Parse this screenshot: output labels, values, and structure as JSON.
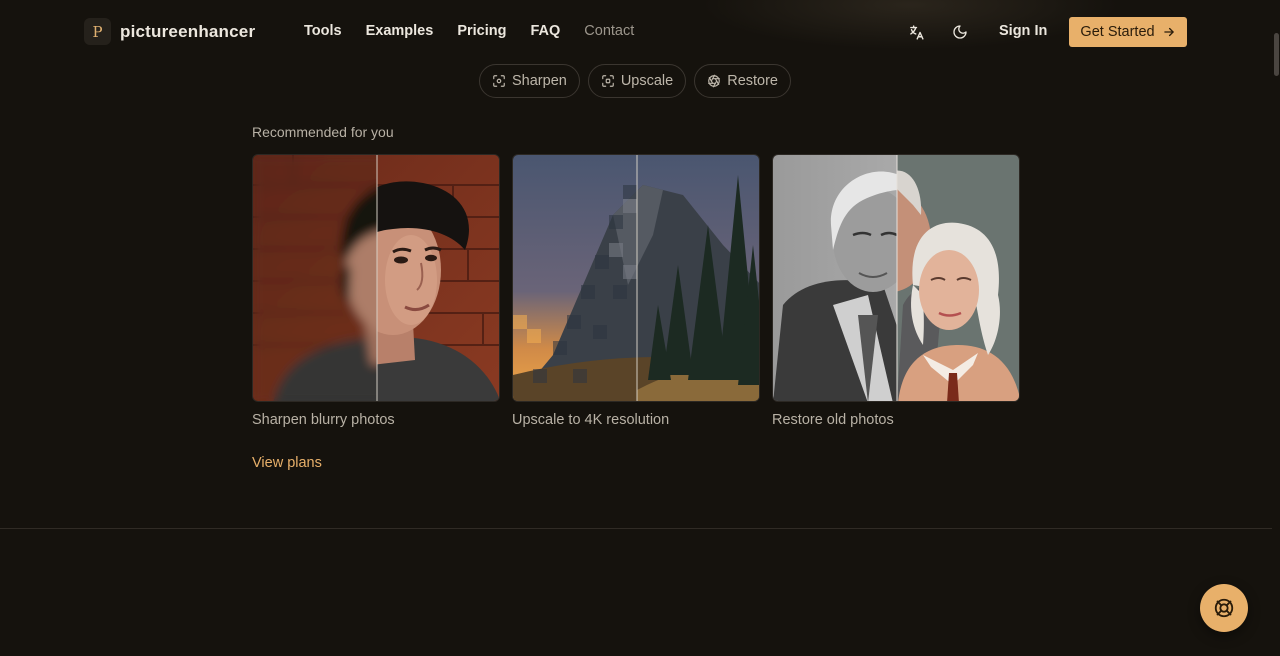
{
  "brand": {
    "mark": "P",
    "name": "pictureenhancer"
  },
  "nav": {
    "links": [
      "Tools",
      "Examples",
      "Pricing",
      "FAQ",
      "Contact"
    ],
    "translate_icon": "translate-icon",
    "theme_icon": "moon-icon",
    "sign_in": "Sign In",
    "cta": "Get Started"
  },
  "pills": [
    {
      "label": "Sharpen",
      "icon": "focus-icon"
    },
    {
      "label": "Upscale",
      "icon": "scan-icon"
    },
    {
      "label": "Restore",
      "icon": "aperture-icon"
    }
  ],
  "recommended": {
    "title": "Recommended for you",
    "cards": [
      {
        "label": "Sharpen blurry photos"
      },
      {
        "label": "Upscale to 4K resolution"
      },
      {
        "label": "Restore old photos"
      }
    ],
    "view_plans": "View plans"
  },
  "help_icon": "lifebuoy-icon",
  "colors": {
    "accent": "#e8b06a",
    "background": "#15120d"
  }
}
